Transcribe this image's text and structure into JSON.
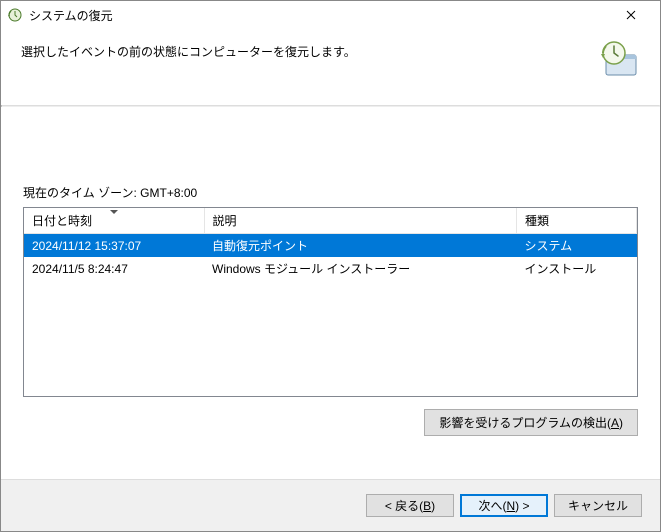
{
  "titlebar": {
    "title": "システムの復元"
  },
  "header": {
    "instruction": "選択したイベントの前の状態にコンピューターを復元します。"
  },
  "timezone_label": "現在のタイム ゾーン: GMT+8:00",
  "columns": {
    "date": "日付と時刻",
    "desc": "説明",
    "type": "種類"
  },
  "rows": [
    {
      "date": "2024/11/12 15:37:07",
      "desc": "自動復元ポイント",
      "type": "システム",
      "selected": true
    },
    {
      "date": "2024/11/5 8:24:47",
      "desc": "Windows モジュール インストーラー",
      "type": "インストール",
      "selected": false
    }
  ],
  "scan_button": {
    "pre": "影響を受けるプログラムの検出(",
    "u": "A",
    "post": ")"
  },
  "footer": {
    "back": {
      "pre": "< 戻る(",
      "u": "B",
      "post": ")"
    },
    "next": {
      "pre": "次へ(",
      "u": "N",
      "post": ") >"
    },
    "cancel": "キャンセル"
  }
}
